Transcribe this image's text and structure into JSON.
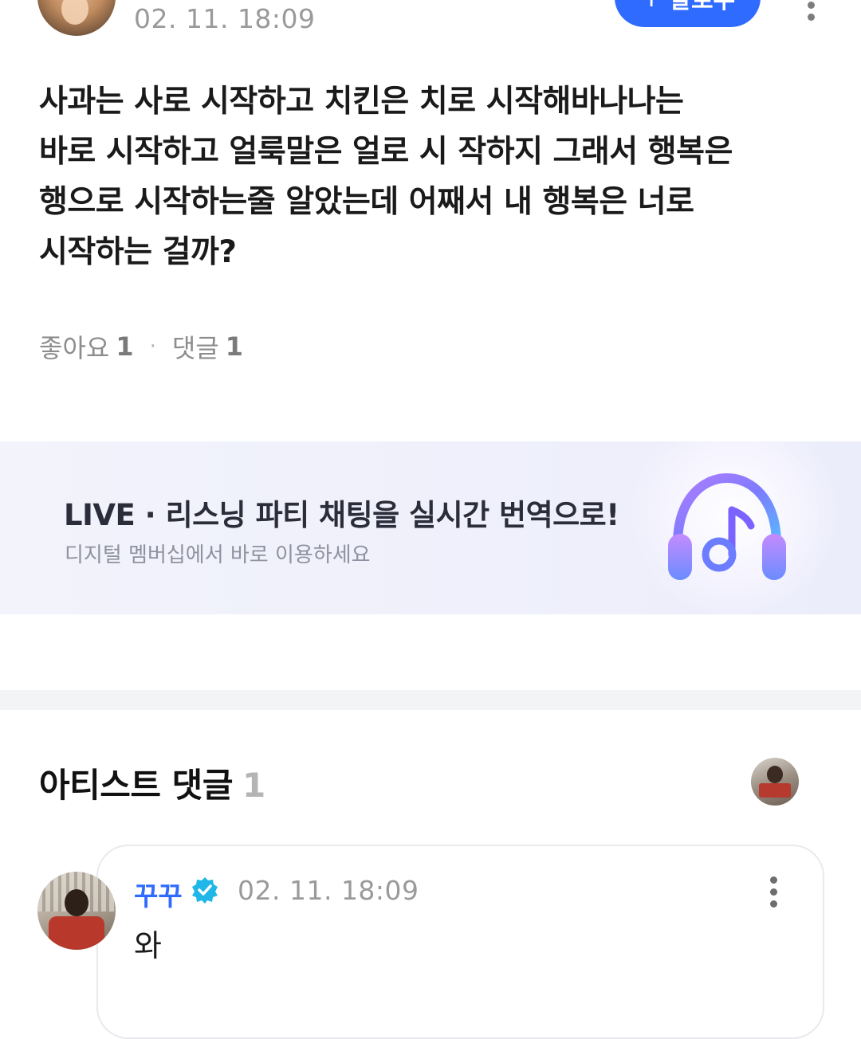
{
  "post": {
    "timestamp": "02. 11. 18:09",
    "follow_label": "팔로우",
    "follow_plus": "+",
    "body_lines": [
      "사과는 사로 시작하고 치킨은 치로 시작해바나나는",
      "바로 시작하고 얼룩말은 얼로 시 작하지 그래서 행복은",
      "행으로 시작하는줄 알았는데 어째서 내 행복은 너로",
      "시작하는 걸까?"
    ],
    "likes_label": "좋아요",
    "likes_count": "1",
    "separator": "·",
    "comments_label": "댓글",
    "comments_count": "1"
  },
  "banner": {
    "title": "LIVE · 리스닝 파티 채팅을 실시간 번역으로!",
    "subtitle": "디지털 멤버십에서 바로 이용하세요",
    "icon": "headphones-music-icon"
  },
  "artist_comments": {
    "title": "아티스트 댓글",
    "count": "1",
    "comment": {
      "author": "꾸꾸",
      "verified_icon": "verified-badge-icon",
      "timestamp": "02. 11. 18:09",
      "text": "와"
    }
  },
  "colors": {
    "accent": "#2f6bff",
    "verified": "#1fb6e8",
    "banner_bg": "#eff0fb",
    "muted_text": "#9a9a9a"
  }
}
